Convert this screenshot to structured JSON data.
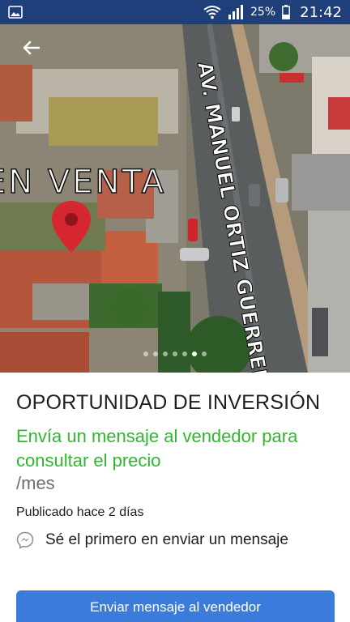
{
  "status_bar": {
    "battery": "25%",
    "time": "21:42"
  },
  "listing": {
    "image_text": {
      "en_venta": "EN VENTA",
      "street": "AV. MANUEL ORTIZ GUERRERO"
    },
    "carousel": {
      "count": 7,
      "active_index": 5
    },
    "title": "OPORTUNIDAD DE INVERSIÓN",
    "price_cta": "Envía un mensaje al vendedor para consultar el precio",
    "price_period": "/mes",
    "published": "Publicado hace 2 días",
    "first_message": "Sé el primero en enviar un mensaje",
    "send_button": "Enviar mensaje al vendedor"
  },
  "colors": {
    "status_bar": "#1f3f7a",
    "price_green": "#2eb82e",
    "button_blue": "#3b7bdc",
    "pin_red": "#d6262f"
  },
  "icons": {
    "back": "arrow-left-icon",
    "messenger": "messenger-icon",
    "pin": "location-pin-icon"
  }
}
